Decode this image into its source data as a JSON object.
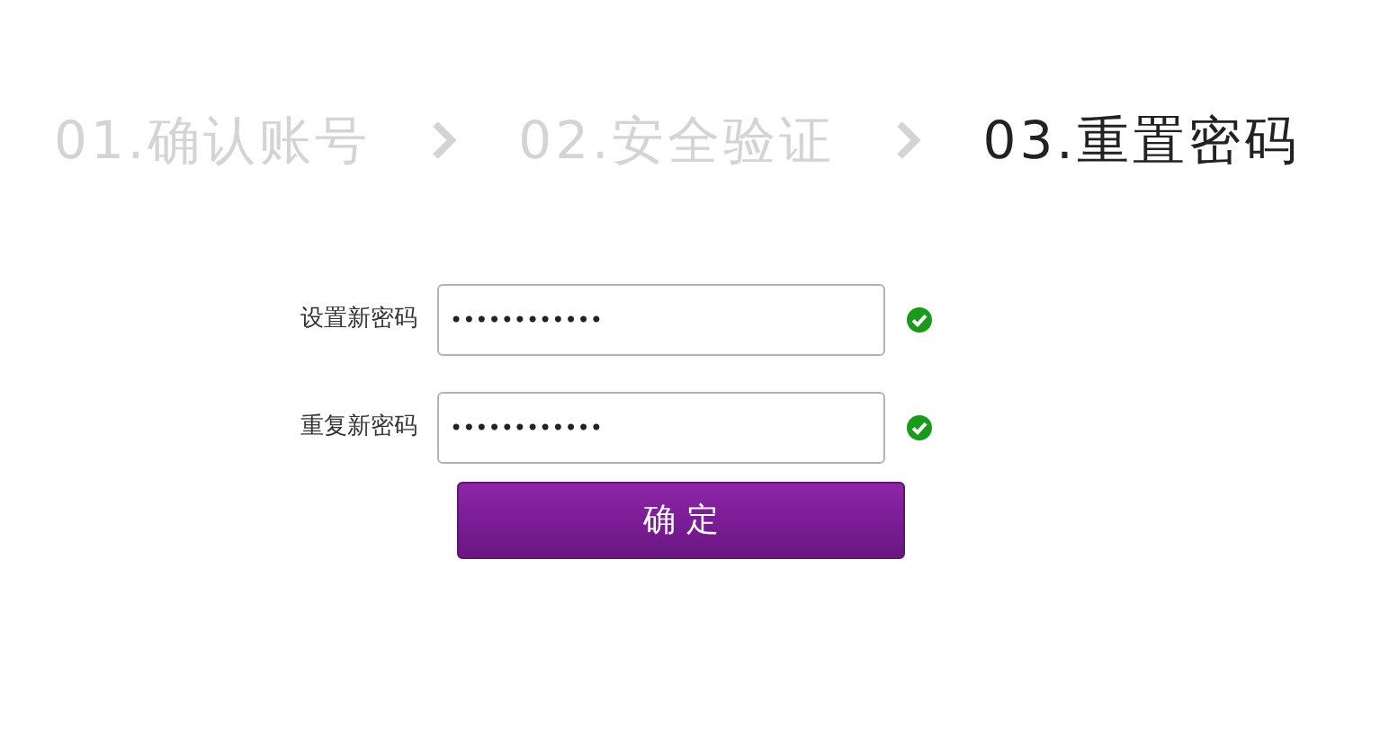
{
  "steps": [
    {
      "label": "01.确认账号",
      "selected": false
    },
    {
      "label": "02.安全验证",
      "selected": false
    },
    {
      "label": "03.重置密码",
      "selected": true
    }
  ],
  "fields": [
    {
      "label": "设置新密码",
      "value": "••••••••••••",
      "valid": true
    },
    {
      "label": "重复新密码",
      "value": "••••••••••••",
      "valid": true
    }
  ],
  "submit_button": "确 定"
}
